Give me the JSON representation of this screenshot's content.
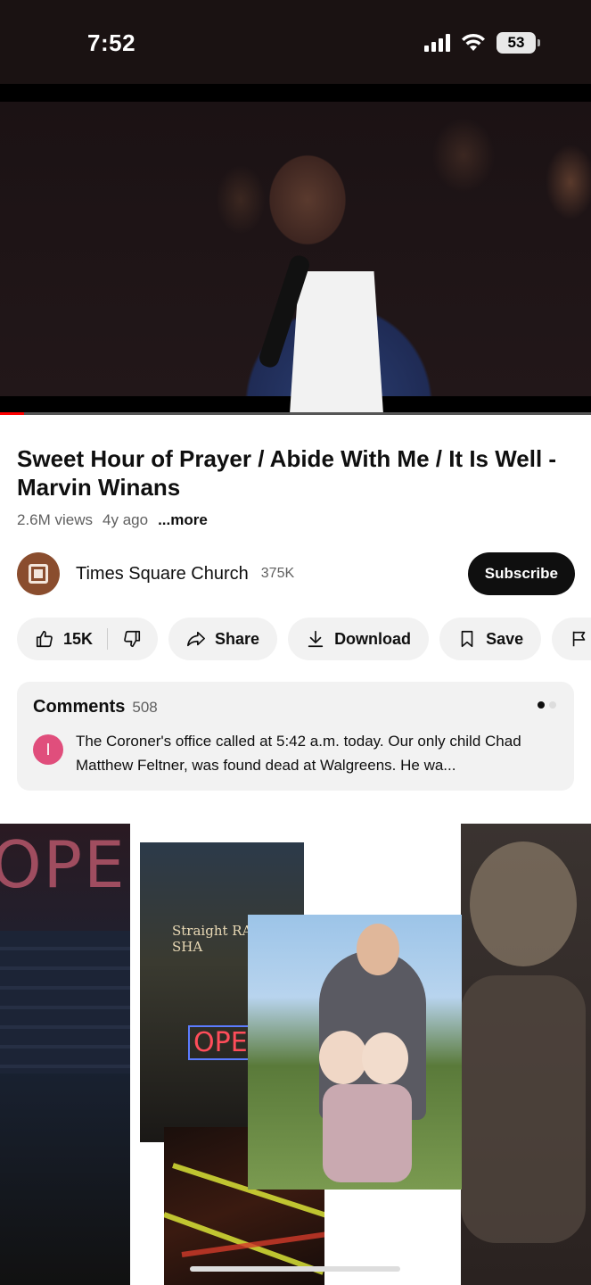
{
  "status_bar": {
    "time": "7:52",
    "battery": "53"
  },
  "video": {
    "progress_fraction": 0.04,
    "progress_color": "#ff0000"
  },
  "video_info": {
    "title": "Sweet Hour of Prayer / Abide With Me / It Is Well - Marvin Winans",
    "views": "2.6M views",
    "age": "4y ago",
    "more_label": "...more"
  },
  "channel": {
    "name": "Times Square Church",
    "subscribers": "375K",
    "subscribe_label": "Subscribe"
  },
  "actions": {
    "likes": "15K",
    "share": "Share",
    "download": "Download",
    "save": "Save",
    "report_partial": "R"
  },
  "comments": {
    "title": "Comments",
    "count": "508",
    "commenter_initial": "I",
    "text": "The Coroner's office called at 5:42 a.m. today. Our only child Chad Matthew Feltner,  was found dead at Walgreens.  He wa..."
  },
  "ad": {
    "open_sign_big": "OPE",
    "shop_sign": "Straight RAZOR SHA",
    "open_sign_small": "OPE"
  },
  "colors": {
    "subscribe_bg": "#0f0f0f",
    "pill_bg": "#f2f2f2",
    "commenter_avatar": "#e04e7c",
    "channel_avatar": "#8a4d2e"
  }
}
